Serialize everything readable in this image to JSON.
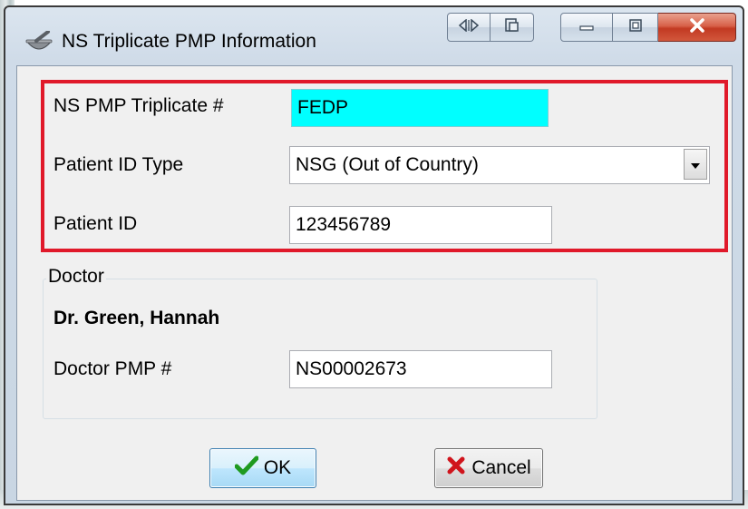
{
  "window": {
    "title": "NS Triplicate PMP Information"
  },
  "form": {
    "triplicate_label": "NS PMP Triplicate #",
    "triplicate_value": "FEDP",
    "patient_id_type_label": "Patient ID Type",
    "patient_id_type_value": "NSG (Out of Country)",
    "patient_id_label": "Patient ID",
    "patient_id_value": "123456789"
  },
  "doctor": {
    "group_label": "Doctor",
    "name": "Dr. Green, Hannah",
    "pmp_label": "Doctor PMP #",
    "pmp_value": "NS00002673"
  },
  "buttons": {
    "ok_label": "OK",
    "cancel_label": "Cancel"
  },
  "icons": {
    "app": "mortar-pestle-icon",
    "title_ext1": "left-right-arrows-icon",
    "title_ext2": "copy-window-icon",
    "minimize": "minimize-icon",
    "maximize": "maximize-icon",
    "close": "close-icon",
    "dropdown": "chevron-down-icon",
    "ok": "checkmark-icon",
    "cancel": "red-x-icon"
  },
  "colors": {
    "highlight_border": "#e0192a",
    "triplicate_field_bg": "#00ffff",
    "close_button": "#c23a22",
    "ok_check": "#1f9a1f",
    "cancel_x": "#d0141c"
  }
}
